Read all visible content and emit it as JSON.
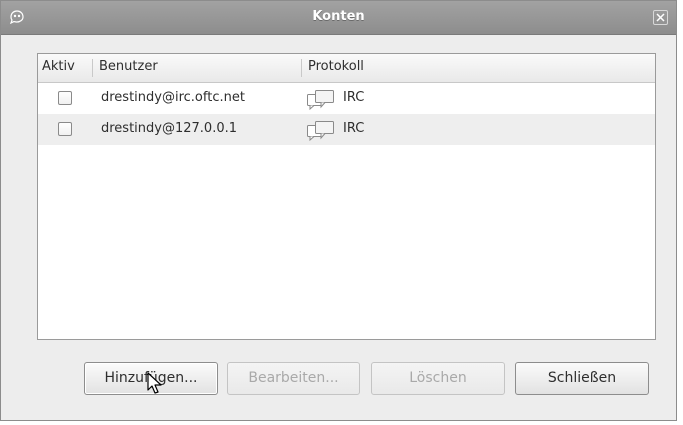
{
  "window": {
    "title": "Konten",
    "app_icon": "pidgin-icon",
    "close_icon": "close-icon"
  },
  "table": {
    "headers": {
      "active": "Aktiv",
      "user": "Benutzer",
      "protocol": "Protokoll"
    },
    "rows": [
      {
        "active": false,
        "user": "drestindy@irc.oftc.net",
        "protocol": "IRC",
        "protocol_icon": "chat-bubbles-icon"
      },
      {
        "active": false,
        "user": "drestindy@127.0.0.1",
        "protocol": "IRC",
        "protocol_icon": "chat-bubbles-icon"
      }
    ]
  },
  "buttons": {
    "add": {
      "label": "Hinzufügen...",
      "enabled": true
    },
    "edit": {
      "label": "Bearbeiten...",
      "enabled": false
    },
    "delete": {
      "label": "Löschen",
      "enabled": false
    },
    "close": {
      "label": "Schließen",
      "enabled": true
    }
  },
  "colors": {
    "titlebar": "#959595",
    "dialog_bg": "#ededed",
    "alt_row": "#eeeeee"
  }
}
